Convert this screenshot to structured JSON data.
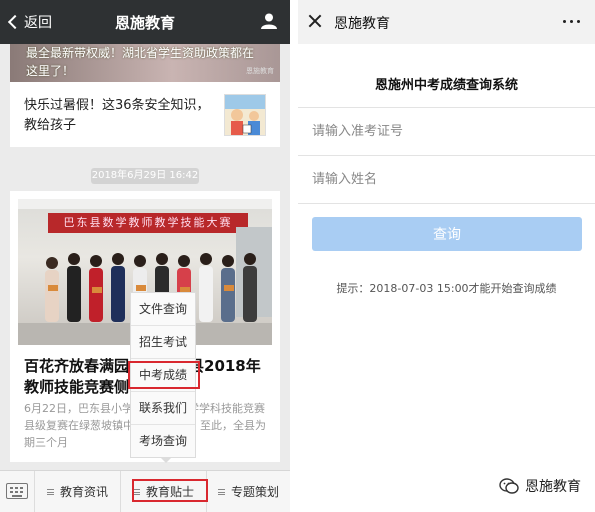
{
  "left_screen": {
    "nav": {
      "back_label": "返回",
      "title": "恩施教育"
    },
    "card1": {
      "banner_text": "最全最新带权威！湖北省学生资助政策都在这里了！",
      "banner_watermark": "恩施教育",
      "text": "快乐过暑假！这36条安全知识，教给孩子"
    },
    "timestamp": "2018年6月29日 16:42",
    "card2": {
      "photo_banner": "巴东县数学教师教学技能大赛",
      "title": "百花齐放春满园——巴东县2018年教师技能竞赛侧记",
      "desc": "6月22日，巴东县小学数学教师教学学科技能竞赛县级复赛在绿葱坡镇中心学校举行。至此，全县为期三个月"
    },
    "popup_menu": [
      "文件查询",
      "招生考试",
      "中考成绩",
      "联系我们",
      "考场查询"
    ],
    "tabs": [
      "教育资讯",
      "教育贴士",
      "专题策划"
    ]
  },
  "right_screen": {
    "header_title": "恩施教育",
    "system_title": "恩施州中考成绩查询系统",
    "exam_number_placeholder": "请输入准考证号",
    "name_placeholder": "请输入姓名",
    "query_button": "查询",
    "hint": "提示：2018-07-03 15:00才能开始查询成绩",
    "watermark": "恩施教育"
  },
  "colors": {
    "topbar": "#2e3133",
    "highlight_red": "#d9282f",
    "query_button": "#a9cdf3"
  },
  "icons": [
    "chevron-left-icon",
    "person-icon",
    "keyboard-icon",
    "close-icon",
    "more-icon",
    "wechat-icon"
  ]
}
